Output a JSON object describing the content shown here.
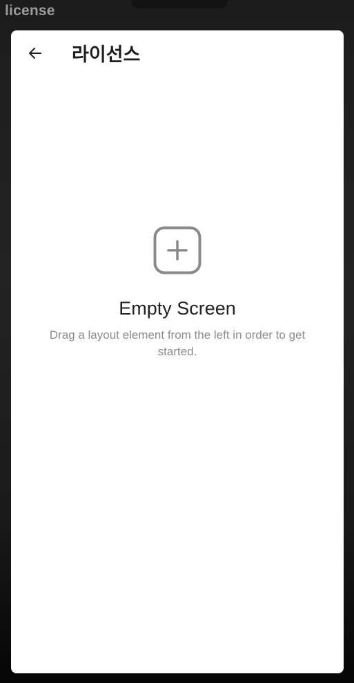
{
  "window": {
    "label": "license"
  },
  "app_bar": {
    "title": "라이선스",
    "back_icon": "arrow-left-icon"
  },
  "empty_state": {
    "icon": "add-square-icon",
    "title": "Empty Screen",
    "description": "Drag a layout element from the left in order to get started."
  },
  "colors": {
    "background": "#1c1c1c",
    "surface": "#ffffff",
    "title_text": "#1e1e1e",
    "muted_text": "#8c8c8c",
    "icon_stroke": "#8a8a8a"
  }
}
